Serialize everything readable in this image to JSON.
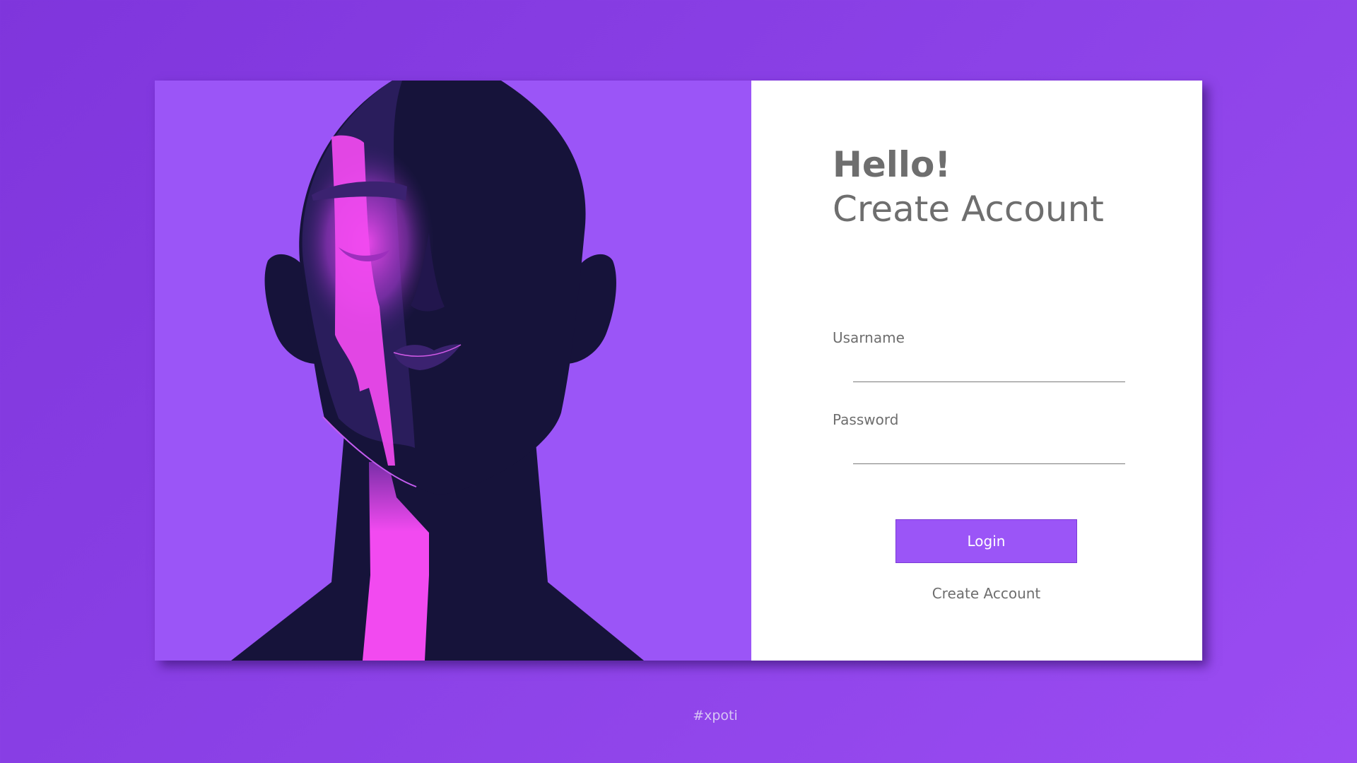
{
  "form": {
    "greeting": "Hello!",
    "subtitle": "Create Account",
    "username_label": "Usarname",
    "username_value": "",
    "password_label": "Password",
    "password_value": "",
    "login_label": "Login",
    "create_account_label": "Create Account"
  },
  "footer": {
    "tag": "#xpoti"
  },
  "colors": {
    "background": "#8a3ee6",
    "accent": "#9b55f7",
    "face_dark": "#16133a",
    "highlight_pink": "#f24af0",
    "text_gray": "#6e6e6e"
  },
  "illustration": {
    "icon": "abstract-head-illustration"
  }
}
